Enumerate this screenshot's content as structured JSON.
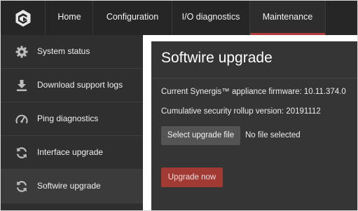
{
  "nav": {
    "logo_icon": "genetec-logo-icon",
    "items": [
      {
        "label": "Home"
      },
      {
        "label": "Configuration"
      },
      {
        "label": "I/O diagnostics"
      },
      {
        "label": "Maintenance",
        "active": true
      }
    ]
  },
  "sidebar": {
    "items": [
      {
        "label": "System status",
        "icon": "gear-icon"
      },
      {
        "label": "Download support logs",
        "icon": "download-icon"
      },
      {
        "label": "Ping diagnostics",
        "icon": "gauge-icon"
      },
      {
        "label": "Interface upgrade",
        "icon": "refresh-icon"
      },
      {
        "label": "Softwire upgrade",
        "icon": "refresh-icon",
        "active": true
      }
    ]
  },
  "main": {
    "title": "Softwire upgrade",
    "firmware_line": "Current Synergis™ appliance firmware: 10.11.374.0",
    "rollup_line": "Cumulative security rollup version: 20191112",
    "select_button": "Select upgrade file",
    "file_status": "No file selected",
    "upgrade_button": "Upgrade now"
  },
  "colors": {
    "topbar": "#262626",
    "sidebar": "#2f2f2f",
    "panel": "#353535",
    "accent": "#b33a3a",
    "upgrade_button": "#a23a34"
  }
}
